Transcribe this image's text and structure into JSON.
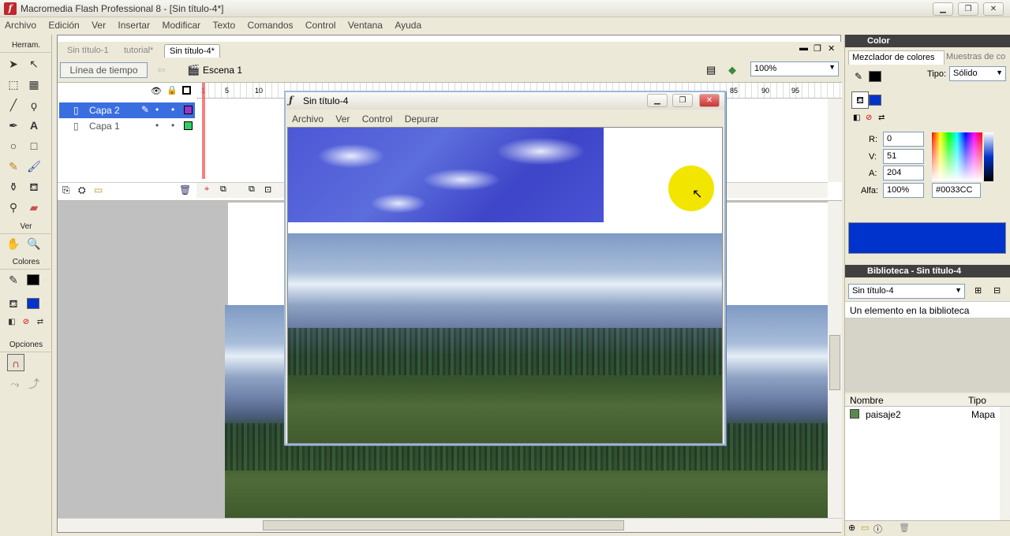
{
  "app": {
    "title": "Macromedia Flash Professional 8 - [Sin título-4*]",
    "icon_letter": "f"
  },
  "menu": [
    "Archivo",
    "Edición",
    "Ver",
    "Insertar",
    "Modificar",
    "Texto",
    "Comandos",
    "Control",
    "Ventana",
    "Ayuda"
  ],
  "tools": {
    "header": "Herram.",
    "ver": "Ver",
    "colores": "Colores",
    "opciones": "Opciones"
  },
  "document": {
    "tabs": [
      "Sin título-1",
      "tutorial*",
      "Sin título-4*"
    ],
    "timeline_button": "Línea de tiempo",
    "scene": "Escena 1",
    "zoom": "100%",
    "ruler": [
      "1",
      "5",
      "10",
      "85",
      "90",
      "95"
    ],
    "layers": [
      {
        "name": "Capa 2",
        "selected": true,
        "color": "#9933cc"
      },
      {
        "name": "Capa 1",
        "selected": false,
        "color": "#33cc66"
      }
    ]
  },
  "popup": {
    "title": "Sin título-4",
    "menu": [
      "Archivo",
      "Ver",
      "Control",
      "Depurar"
    ]
  },
  "color_panel": {
    "title": "Color",
    "tab_mixer": "Mezclador de colores",
    "tab_swatches": "Muestras de co",
    "type_label": "Tipo:",
    "type_value": "Sólido",
    "r_label": "R:",
    "r": "0",
    "g_label": "V:",
    "g": "51",
    "b_label": "A:",
    "b": "204",
    "alpha_label": "Alfa:",
    "alpha": "100%",
    "hex": "#0033CC",
    "fill_color": "#0033cc"
  },
  "library": {
    "title": "Biblioteca - Sin título-4",
    "doc_select": "Sin título-4",
    "count_text": "Un elemento en la biblioteca",
    "col_name": "Nombre",
    "col_type": "Tipo",
    "items": [
      {
        "name": "paisaje2",
        "type": "Mapa"
      }
    ]
  }
}
